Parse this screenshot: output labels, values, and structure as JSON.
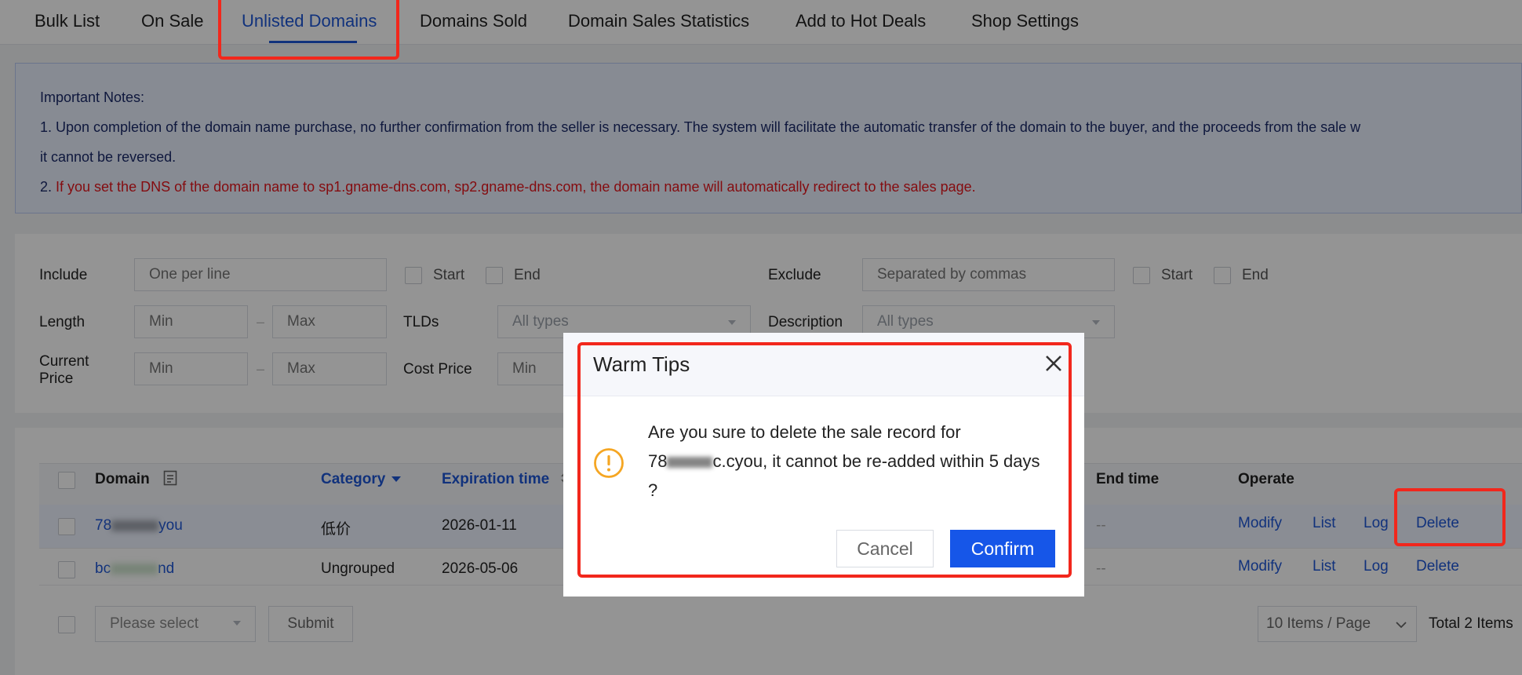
{
  "tabs": [
    "Bulk List",
    "On Sale",
    "Unlisted Domains",
    "Domains Sold",
    "Domain Sales Statistics",
    "Add to Hot Deals",
    "Shop Settings"
  ],
  "active_tab": "Unlisted Domains",
  "notice": {
    "heading": "Important Notes:",
    "line1": "1. Upon completion of the domain name purchase, no further confirmation from the seller is necessary. The system will facilitate the automatic transfer of the domain to the buyer, and the proceeds from the sale w",
    "line1_cont": "it cannot be reversed.",
    "line2_prefix": "2. ",
    "line2_red": "If you set the DNS of the domain name to sp1.gname-dns.com, sp2.gname-dns.com, the domain name will automatically redirect to the sales page."
  },
  "filters": {
    "include_label": "Include",
    "include_placeholder": "One per line",
    "start_label": "Start",
    "end_label": "End",
    "exclude_label": "Exclude",
    "exclude_placeholder": "Separated by commas",
    "length_label": "Length",
    "min_placeholder": "Min",
    "max_placeholder": "Max",
    "range_dash": "–",
    "tlds_label": "TLDs",
    "tlds_value": "All types",
    "description_label": "Description",
    "description_value": "All types",
    "current_price_label_1": "Current",
    "current_price_label_2": "Price",
    "cost_price_label": "Cost Price"
  },
  "table": {
    "headers": {
      "domain": "Domain",
      "category": "Category",
      "expiration": "Expiration time",
      "end_time": "End time",
      "operate": "Operate"
    },
    "rows": [
      {
        "domain_prefix": "78",
        "domain_suffix": "you",
        "category": "低价",
        "expiration": "2026-01-11",
        "end_time": "--"
      },
      {
        "domain_prefix": "bc",
        "domain_suffix": "nd",
        "category": "Ungrouped",
        "expiration": "2026-05-06",
        "end_time": "--"
      }
    ],
    "ops": {
      "modify": "Modify",
      "list": "List",
      "log": "Log",
      "delete": "Delete"
    }
  },
  "footer": {
    "bulk_select": "Please select",
    "submit": "Submit",
    "page_size": "10 Items / Page",
    "total": "Total 2 Items"
  },
  "modal": {
    "title": "Warm Tips",
    "message_1": "Are you sure to delete the sale record for",
    "message_domain_prefix": "78",
    "message_domain_suffix": "c.cyou, it cannot be re-added within 5 days",
    "message_3": "?",
    "cancel": "Cancel",
    "confirm": "Confirm"
  },
  "colors": {
    "accent": "#1e56d6",
    "confirm_button": "#1656e8",
    "warning": "#f5a623",
    "annotation": "#f2271c",
    "notice_red": "#e3161c"
  }
}
